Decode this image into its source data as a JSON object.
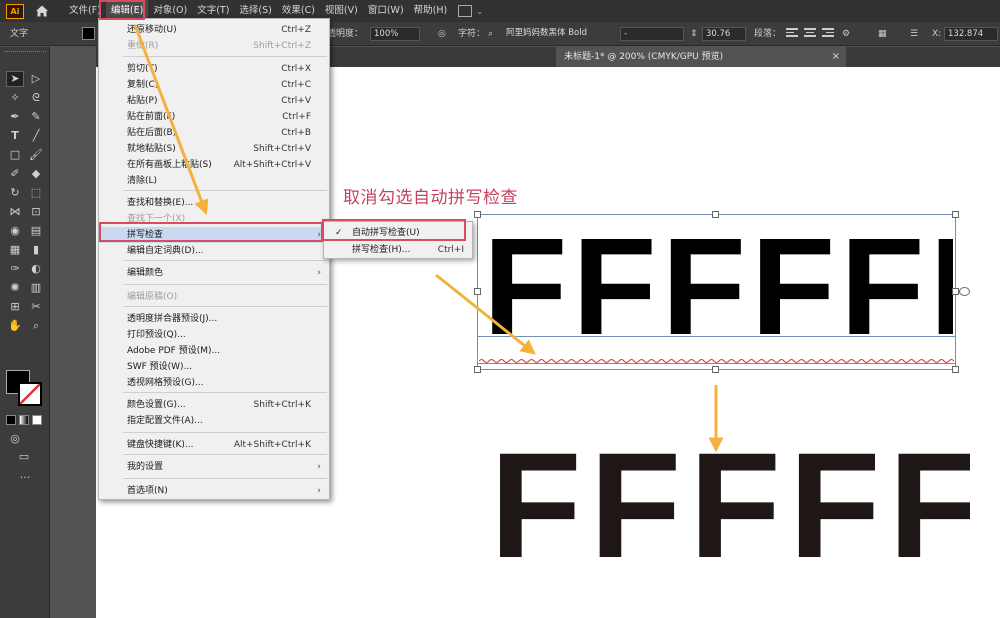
{
  "app": {
    "logo_text": "Ai"
  },
  "menubar": {
    "items": [
      "文件(F)",
      "编辑(E)",
      "对象(O)",
      "文字(T)",
      "选择(S)",
      "效果(C)",
      "视图(V)",
      "窗口(W)",
      "帮助(H)"
    ],
    "active_index": 1
  },
  "controlbar": {
    "tool_name": "文字",
    "opacity_label": "不透明度：",
    "opacity_value": "100%",
    "char_label": "字符：",
    "font_name": "阿里妈妈数黑体 Bold",
    "font_style": "-",
    "font_size": "30.76",
    "paragraph_label": "段落：",
    "x_label": "X:",
    "x_value": "132.874"
  },
  "document_tab": {
    "title": "未标题-1* @ 200% (CMYK/GPU 预览)",
    "close_glyph": "×"
  },
  "toolbar": {
    "more_glyph": "···"
  },
  "edit_menu": {
    "items": [
      {
        "label": "还原移动(U)",
        "shortcut": "Ctrl+Z",
        "disabled": false
      },
      {
        "label": "重做(R)",
        "shortcut": "Shift+Ctrl+Z",
        "disabled": true
      },
      {
        "label": "剪切(T)",
        "shortcut": "Ctrl+X",
        "disabled": false
      },
      {
        "label": "复制(C)",
        "shortcut": "Ctrl+C",
        "disabled": false
      },
      {
        "label": "粘贴(P)",
        "shortcut": "Ctrl+V",
        "disabled": false
      },
      {
        "label": "贴在前面(F)",
        "shortcut": "Ctrl+F",
        "disabled": false
      },
      {
        "label": "贴在后面(B)",
        "shortcut": "Ctrl+B",
        "disabled": false
      },
      {
        "label": "就地粘贴(S)",
        "shortcut": "Shift+Ctrl+V",
        "disabled": false
      },
      {
        "label": "在所有画板上粘贴(S)",
        "shortcut": "Alt+Shift+Ctrl+V",
        "disabled": false
      },
      {
        "label": "清除(L)",
        "shortcut": "",
        "disabled": false
      },
      {
        "label": "查找和替换(E)...",
        "shortcut": "",
        "disabled": false
      },
      {
        "label": "查找下一个(X)",
        "shortcut": "",
        "disabled": true
      },
      {
        "label": "拼写检查",
        "shortcut": "",
        "disabled": false,
        "submenu": true
      },
      {
        "label": "编辑自定词典(D)...",
        "shortcut": "",
        "disabled": false
      },
      {
        "label": "编辑颜色",
        "shortcut": "",
        "disabled": false,
        "submenu": true
      },
      {
        "label": "编辑原稿(O)",
        "shortcut": "",
        "disabled": true
      },
      {
        "label": "透明度拼合器预设(J)...",
        "shortcut": "",
        "disabled": false
      },
      {
        "label": "打印预设(Q)...",
        "shortcut": "",
        "disabled": false
      },
      {
        "label": "Adobe PDF 预设(M)...",
        "shortcut": "",
        "disabled": false
      },
      {
        "label": "SWF 预设(W)...",
        "shortcut": "",
        "disabled": false
      },
      {
        "label": "透视网格预设(G)...",
        "shortcut": "",
        "disabled": false
      },
      {
        "label": "颜色设置(G)...",
        "shortcut": "Shift+Ctrl+K",
        "disabled": false
      },
      {
        "label": "指定配置文件(A)...",
        "shortcut": "",
        "disabled": false
      },
      {
        "label": "键盘快捷键(K)...",
        "shortcut": "Alt+Shift+Ctrl+K",
        "disabled": false
      },
      {
        "label": "我的设置",
        "shortcut": "",
        "disabled": false,
        "submenu": true
      },
      {
        "label": "首选项(N)",
        "shortcut": "",
        "disabled": false,
        "submenu": true
      }
    ],
    "submenu_glyph": "›"
  },
  "spelling_submenu": {
    "items": [
      {
        "label": "自动拼写检查(U)",
        "shortcut": "",
        "checked": true
      },
      {
        "label": "拼写检查(H)...",
        "shortcut": "Ctrl+I",
        "checked": false
      }
    ],
    "check_glyph": "✓"
  },
  "annotation": "取消勾选自动拼写检查",
  "canvas": {
    "text_before": "FFFFFF",
    "text_after": "FFFFFF"
  },
  "colors": {
    "annotation_red": "#c8415e",
    "highlight_box": "#d94c5f",
    "arrow": "#f4b13c",
    "selection_blue": "#6f8fb8"
  }
}
